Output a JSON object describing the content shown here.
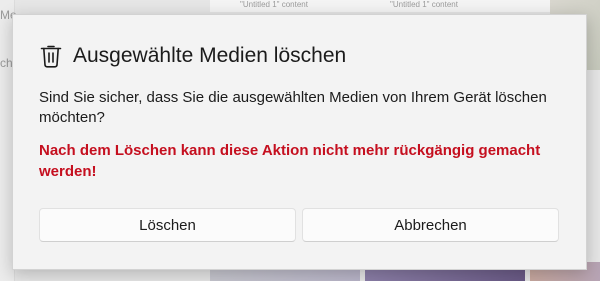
{
  "background": {
    "left_panel_labels": [
      "Me",
      "ch"
    ],
    "top_captions": [
      "\"Untitled 1\" content",
      "\"Untitled 1\" content"
    ]
  },
  "dialog": {
    "icon": "trash-icon",
    "title": "Ausgewählte Medien löschen",
    "message": "Sind Sie sicher, dass Sie die ausgewählten Medien von Ihrem Gerät löschen möchten?",
    "warning": "Nach dem Löschen kann diese Aktion nicht mehr rückgängig gemacht werden!",
    "warning_color": "#c50f1f",
    "buttons": {
      "delete_label": "Löschen",
      "cancel_label": "Abbrechen"
    }
  }
}
